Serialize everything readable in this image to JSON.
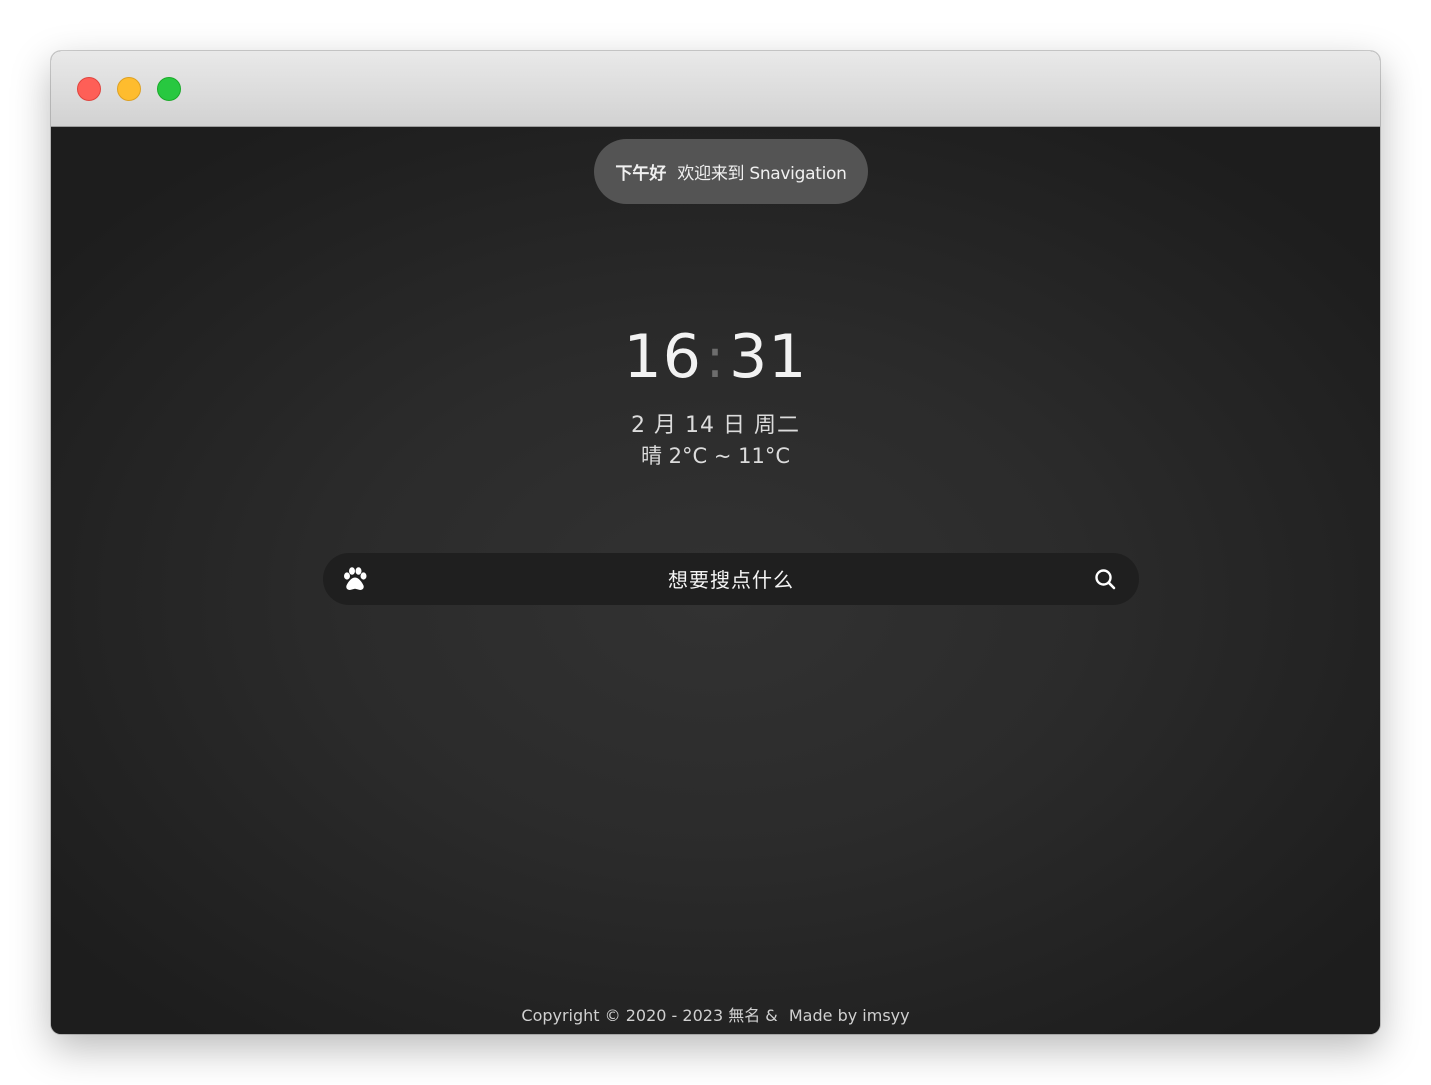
{
  "window": {
    "controls": {
      "close_color": "#fe5f57",
      "minimize_color": "#febc2e",
      "maximize_color": "#28c840"
    }
  },
  "greeting": {
    "time_of_day": "下午好",
    "message": "欢迎来到 Snavigation"
  },
  "clock": {
    "hour": "16",
    "separator": ":",
    "minute": "31"
  },
  "date": {
    "text": "2 月 14 日 周二"
  },
  "weather": {
    "text": "晴 2°C ~ 11°C"
  },
  "search": {
    "engine_icon": "baidu-paw-icon",
    "placeholder": "想要搜点什么",
    "submit_icon": "search-icon"
  },
  "footer": {
    "copyright": "Copyright © 2020 - 2023 無名 &",
    "made_by": "Made by imsyy"
  },
  "theme": {
    "background": "#2b2b2b",
    "pill": "#545454",
    "search_bg": "#1f1f1f"
  }
}
